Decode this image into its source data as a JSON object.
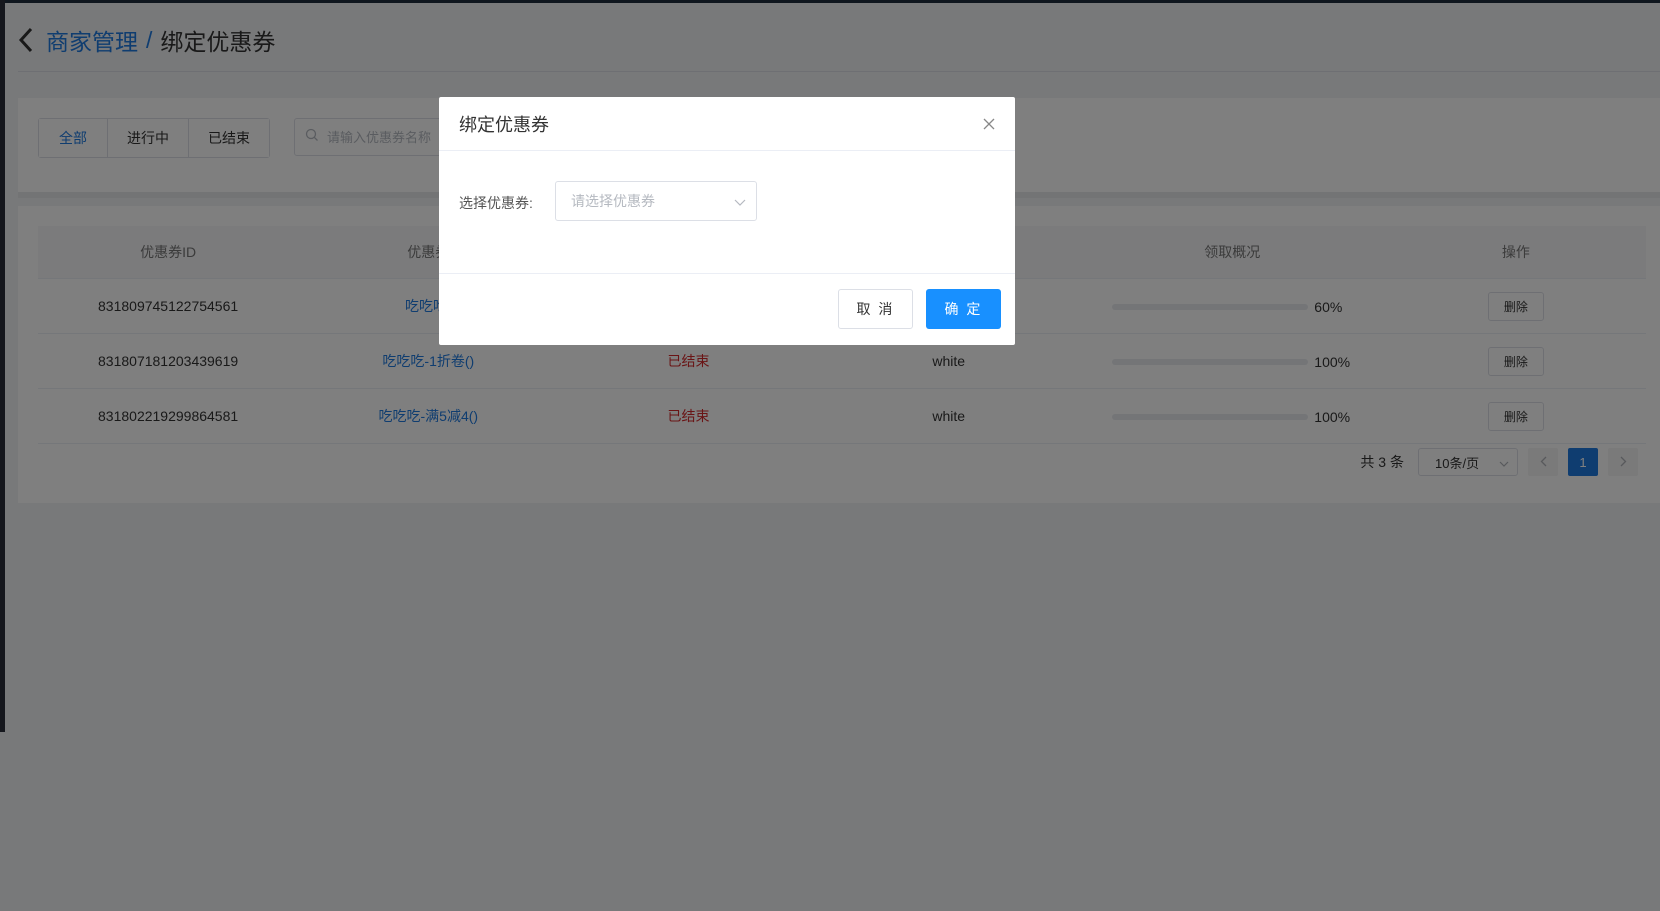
{
  "header": {
    "breadcrumb_parent": "商家管理",
    "breadcrumb_separator": "/",
    "breadcrumb_current": "绑定优惠券"
  },
  "filter": {
    "tabs": [
      {
        "label": "全部",
        "active": true
      },
      {
        "label": "进行中",
        "active": false
      },
      {
        "label": "已结束",
        "active": false
      }
    ],
    "search_placeholder": "请输入优惠券名称"
  },
  "table": {
    "columns": [
      "优惠券ID",
      "优惠券",
      "",
      "",
      "领取概况",
      "操作"
    ],
    "rows": [
      {
        "id": "831809745122754561",
        "name": "吃吃吃-",
        "status": "",
        "color": "",
        "progress_percent": 60,
        "progress_label": "60%",
        "action": "删除"
      },
      {
        "id": "831807181203439619",
        "name": "吃吃吃-1折卷()",
        "status": "已结束",
        "color": "white",
        "progress_percent": 100,
        "progress_label": "100%",
        "action": "删除"
      },
      {
        "id": "831802219299864581",
        "name": "吃吃吃-满5减4()",
        "status": "已结束",
        "color": "white",
        "progress_percent": 100,
        "progress_label": "100%",
        "action": "删除"
      }
    ]
  },
  "pagination": {
    "total": "共 3 条",
    "page_size": "10条/页",
    "current_page": "1"
  },
  "modal": {
    "title": "绑定优惠券",
    "field_label": "选择优惠券:",
    "select_placeholder": "请选择优惠券",
    "cancel_label": "取 消",
    "confirm_label": "确 定"
  },
  "colors": {
    "primary": "#1f7ae0",
    "confirm_button": "#1890ff",
    "status_ended": "#d4292a"
  }
}
